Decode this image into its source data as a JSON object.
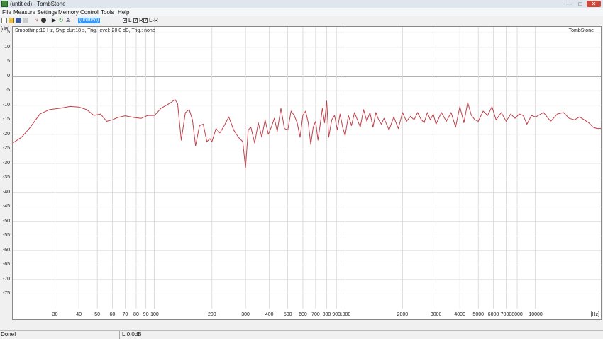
{
  "window": {
    "title": "(untitled) - TombStone",
    "min_glyph": "—",
    "max_glyph": "□",
    "close_glyph": "✕"
  },
  "menu": [
    "File",
    "Measure",
    "Settings",
    "Memory",
    "Control",
    "Tools",
    "Help"
  ],
  "toolbar": {
    "memory_name": "(untitled)",
    "checkboxes": [
      "L",
      "R",
      "L-R"
    ],
    "icons": [
      "new-icon",
      "open-icon",
      "save-icon",
      "print-icon",
      "microphone-icon",
      "record-icon",
      "play-icon",
      "loop-icon",
      "person-icon"
    ]
  },
  "plot": {
    "info_text": "Smoothing:10 Hz, Swp dur:18 s, Trig. level:-20,0 dB, Trig.: none",
    "watermark": "TombStone"
  },
  "status": {
    "left": "Done!",
    "mid": "L:0,0dB"
  },
  "chart_data": {
    "type": "line",
    "title": "",
    "xlabel": "[Hz]",
    "ylabel": "[dB]",
    "x_scale": "log",
    "xlim": [
      18,
      22000
    ],
    "ylim": [
      -80,
      17
    ],
    "grid": true,
    "y_ticks": [
      15,
      10,
      5,
      0,
      -5,
      -10,
      -15,
      -20,
      -25,
      -30,
      -35,
      -40,
      -45,
      -50,
      -55,
      -60,
      -65,
      -70,
      -75
    ],
    "x_ticks": [
      {
        "v": 30,
        "label": "30"
      },
      {
        "v": 40,
        "label": "40"
      },
      {
        "v": 50,
        "label": "50"
      },
      {
        "v": 60,
        "label": "60"
      },
      {
        "v": 70,
        "label": "70"
      },
      {
        "v": 80,
        "label": "80"
      },
      {
        "v": 90,
        "label": "90"
      },
      {
        "v": 100,
        "label": "100"
      },
      {
        "v": 200,
        "label": "200"
      },
      {
        "v": 300,
        "label": "300"
      },
      {
        "v": 400,
        "label": "400"
      },
      {
        "v": 500,
        "label": "500"
      },
      {
        "v": 600,
        "label": "600"
      },
      {
        "v": 700,
        "label": "700"
      },
      {
        "v": 800,
        "label": "800"
      },
      {
        "v": 900,
        "label": "900"
      },
      {
        "v": 1000,
        "label": "1000"
      },
      {
        "v": 2000,
        "label": "2000"
      },
      {
        "v": 3000,
        "label": "3000"
      },
      {
        "v": 4000,
        "label": "4000"
      },
      {
        "v": 5000,
        "label": "5000"
      },
      {
        "v": 6000,
        "label": "6000"
      },
      {
        "v": 7000,
        "label": "7000"
      },
      {
        "v": 8000,
        "label": "8000"
      },
      {
        "v": 10000,
        "label": "10000"
      }
    ],
    "series": [
      {
        "color": "#c0404a",
        "x": [
          18,
          20,
          22,
          25,
          28,
          32,
          36,
          40,
          44,
          48,
          52,
          56,
          60,
          64,
          70,
          78,
          85,
          92,
          100,
          108,
          115,
          122,
          128,
          132,
          138,
          145,
          152,
          158,
          164,
          172,
          180,
          188,
          195,
          200,
          210,
          220,
          232,
          245,
          260,
          275,
          290,
          300,
          310,
          320,
          335,
          350,
          365,
          380,
          395,
          410,
          425,
          440,
          460,
          480,
          500,
          520,
          540,
          560,
          580,
          600,
          620,
          640,
          660,
          680,
          700,
          720,
          740,
          760,
          780,
          800,
          820,
          850,
          880,
          910,
          940,
          970,
          1000,
          1040,
          1080,
          1120,
          1160,
          1200,
          1250,
          1300,
          1350,
          1400,
          1450,
          1500,
          1550,
          1600,
          1700,
          1800,
          1900,
          2000,
          2100,
          2200,
          2300,
          2400,
          2500,
          2600,
          2700,
          2800,
          2900,
          3000,
          3200,
          3400,
          3600,
          3800,
          4000,
          4200,
          4400,
          4600,
          4800,
          5000,
          5300,
          5600,
          5900,
          6200,
          6600,
          7000,
          7400,
          7800,
          8200,
          8600,
          9000,
          9500,
          10000,
          11000,
          12000,
          13000,
          14000,
          15000,
          16000,
          17000,
          18000,
          19000,
          20000,
          21000,
          22000
        ],
        "y": [
          -23,
          -21,
          -18,
          -13,
          -11.5,
          -11,
          -10.4,
          -10.6,
          -11.5,
          -13.5,
          -13,
          -15.5,
          -15,
          -14.2,
          -13.6,
          -14.2,
          -14.5,
          -13.5,
          -13.5,
          -11,
          -10,
          -9,
          -8,
          -9.5,
          -22,
          -12.5,
          -11.5,
          -15,
          -24,
          -17,
          -16.5,
          -22.5,
          -21.5,
          -22.5,
          -18,
          -19.5,
          -17,
          -14,
          -18.5,
          -21,
          -22.5,
          -31.5,
          -18.5,
          -17.5,
          -23,
          -16,
          -21,
          -15,
          -20,
          -17.5,
          -14.5,
          -19,
          -11,
          -18,
          -18.5,
          -12,
          -13.5,
          -16,
          -21,
          -13.5,
          -12,
          -16,
          -23.5,
          -17.5,
          -15.5,
          -22,
          -16.5,
          -11,
          -16,
          -8.5,
          -21,
          -15,
          -13.5,
          -18.5,
          -13,
          -17.5,
          -20.5,
          -13.5,
          -17,
          -12.5,
          -15,
          -17.5,
          -11.5,
          -15.5,
          -12.5,
          -17.5,
          -12.5,
          -15,
          -16.5,
          -14.5,
          -18.5,
          -14,
          -18,
          -12.5,
          -15.5,
          -13.8,
          -15,
          -12.5,
          -14.8,
          -16,
          -12.5,
          -15,
          -13,
          -16.5,
          -12.5,
          -15.5,
          -12.5,
          -17.5,
          -10.5,
          -16,
          -9,
          -13.5,
          -15,
          -15.5,
          -12,
          -13.5,
          -10.5,
          -15,
          -12.5,
          -15.5,
          -13,
          -14.5,
          -13,
          -13.5,
          -16.5,
          -13.5,
          -14,
          -12.5,
          -15.5,
          -13,
          -12.5,
          -14.5,
          -15,
          -14,
          -15,
          -16,
          -17.5,
          -18,
          -18
        ]
      }
    ]
  }
}
